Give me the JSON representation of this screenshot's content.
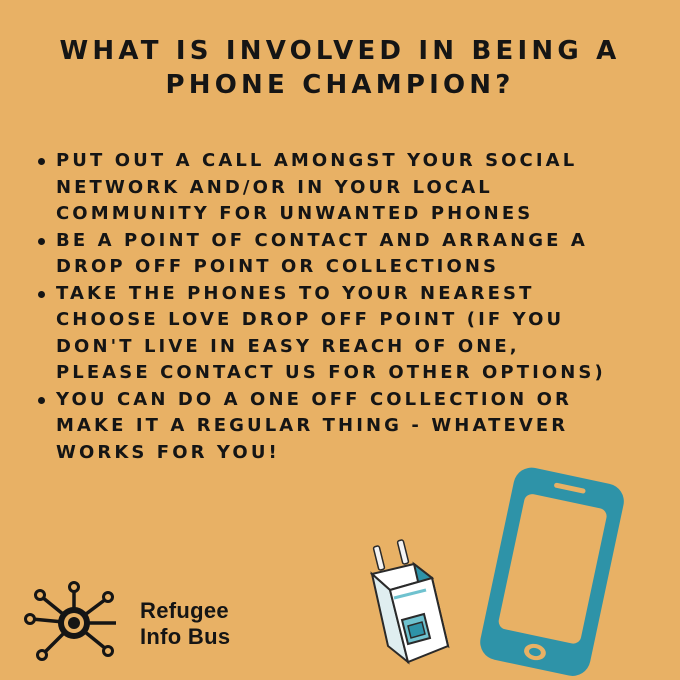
{
  "title": {
    "line1": "WHAT IS INVOLVED IN BEING A",
    "line2": "PHONE CHAMPION?"
  },
  "bullets": [
    {
      "lines": [
        "PUT OUT A CALL AMONGST YOUR SOCIAL",
        "NETWORK AND/OR IN YOUR LOCAL",
        "COMMUNITY FOR UNWANTED PHONES"
      ]
    },
    {
      "lines": [
        "BE A POINT OF CONTACT AND ARRANGE A",
        "DROP OFF POINT OR COLLECTIONS"
      ]
    },
    {
      "lines": [
        "TAKE THE PHONES TO YOUR NEAREST",
        "CHOOSE LOVE DROP OFF POINT (IF YOU",
        "DON'T LIVE IN EASY REACH OF ONE,",
        "PLEASE CONTACT US FOR OTHER OPTIONS)"
      ]
    },
    {
      "lines": [
        "YOU CAN DO A ONE OFF COLLECTION OR",
        "MAKE IT A REGULAR THING - WHATEVER",
        "WORKS FOR YOU!"
      ]
    }
  ],
  "brand": {
    "line1": "Refugee",
    "line2": "Info Bus",
    "logo_icon": "network-hub-icon"
  },
  "illustrations": {
    "phone_icon": "smartphone-icon",
    "charger_icon": "charger-plug-icon"
  },
  "colors": {
    "background": "#e8b165",
    "text": "#151515",
    "accent_teal": "#2e93a8",
    "teal_light": "#6fc2cf"
  }
}
